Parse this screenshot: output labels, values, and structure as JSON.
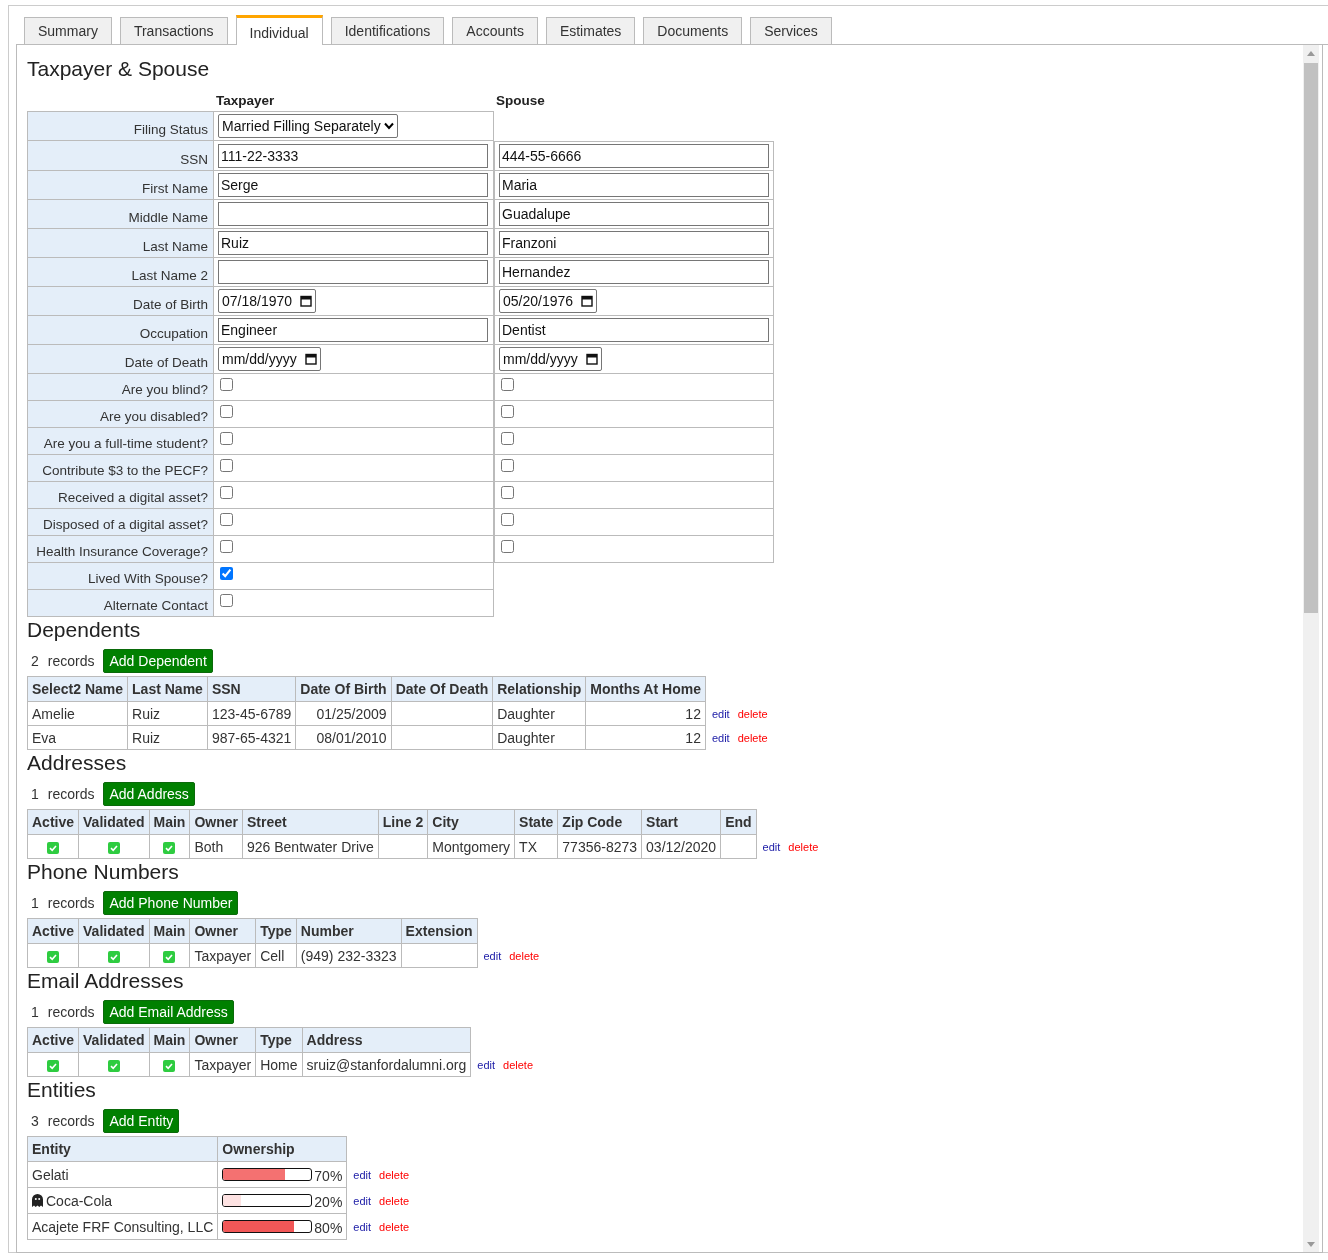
{
  "tabs": [
    {
      "label": "Summary",
      "selected": false
    },
    {
      "label": "Transactions",
      "selected": false
    },
    {
      "label": "Individual",
      "selected": true
    },
    {
      "label": "Identifications",
      "selected": false
    },
    {
      "label": "Accounts",
      "selected": false
    },
    {
      "label": "Estimates",
      "selected": false
    },
    {
      "label": "Documents",
      "selected": false
    },
    {
      "label": "Services",
      "selected": false
    }
  ],
  "taxpayer_spouse": {
    "title": "Taxpayer & Spouse",
    "columns": [
      "Taxpayer",
      "Spouse"
    ],
    "rows": [
      {
        "kind": "select",
        "label": "Filing Status",
        "taxpayer": {
          "value": "Married Filling Separately"
        }
      },
      {
        "kind": "text",
        "label": "SSN",
        "taxpayer": {
          "value": "111-22-3333"
        },
        "spouse": {
          "value": "444-55-6666"
        }
      },
      {
        "kind": "text",
        "label": "First Name",
        "taxpayer": {
          "value": "Serge"
        },
        "spouse": {
          "value": "Maria"
        }
      },
      {
        "kind": "text",
        "label": "Middle Name",
        "taxpayer": {},
        "spouse": {
          "value": "Guadalupe"
        }
      },
      {
        "kind": "text",
        "label": "Last Name",
        "taxpayer": {
          "value": "Ruiz"
        },
        "spouse": {
          "value": "Franzoni"
        }
      },
      {
        "kind": "text",
        "label": "Last Name 2",
        "taxpayer": {},
        "spouse": {
          "value": "Hernandez"
        }
      },
      {
        "kind": "date",
        "label": "Date of Birth",
        "taxpayer": {
          "value": "07/18/1970"
        },
        "spouse": {
          "value": "05/20/1976"
        }
      },
      {
        "kind": "text",
        "label": "Occupation",
        "taxpayer": {
          "value": "Engineer"
        },
        "spouse": {
          "value": "Dentist"
        }
      },
      {
        "kind": "date",
        "label": "Date of Death",
        "taxpayer": {
          "placeholder": "mm/dd/yyyy"
        },
        "spouse": {
          "placeholder": "mm/dd/yyyy"
        }
      },
      {
        "kind": "checkbox",
        "label": "Are you blind?",
        "taxpayer": {
          "checked": false
        },
        "spouse": {
          "checked": false
        }
      },
      {
        "kind": "checkbox",
        "label": "Are you disabled?",
        "taxpayer": {
          "checked": false
        },
        "spouse": {
          "checked": false
        }
      },
      {
        "kind": "checkbox",
        "label": "Are you a full-time student?",
        "taxpayer": {
          "checked": false
        },
        "spouse": {
          "checked": false
        }
      },
      {
        "kind": "checkbox",
        "label": "Contribute $3 to the PECF?",
        "taxpayer": {
          "checked": false
        },
        "spouse": {
          "checked": false
        }
      },
      {
        "kind": "checkbox",
        "label": "Received a digital asset?",
        "taxpayer": {
          "checked": false
        },
        "spouse": {
          "checked": false
        }
      },
      {
        "kind": "checkbox",
        "label": "Disposed of a digital asset?",
        "taxpayer": {
          "checked": false
        },
        "spouse": {
          "checked": false
        }
      },
      {
        "kind": "checkbox",
        "label": "Health Insurance Coverage?",
        "taxpayer": {
          "checked": false
        },
        "spouse": {
          "checked": false
        }
      },
      {
        "kind": "checkbox",
        "label": "Lived With Spouse?",
        "taxpayer": {
          "checked": true
        }
      },
      {
        "kind": "checkbox",
        "label": "Alternate Contact",
        "taxpayer": {
          "checked": false
        }
      }
    ]
  },
  "sections": [
    {
      "title": "Dependents",
      "count": "2",
      "count_label": "records",
      "add_button": "Add Dependent",
      "columns": [
        "Select2 Name",
        "Last Name",
        "SSN",
        "Date Of Birth",
        "Date Of Death",
        "Relationship",
        "Months At Home"
      ],
      "rows": [
        {
          "cells": [
            {
              "kind": "text",
              "text": "Amelie"
            },
            {
              "kind": "text",
              "text": "Ruiz"
            },
            {
              "kind": "text",
              "text": "123-45-6789"
            },
            {
              "kind": "number",
              "text": "01/25/2009"
            },
            {
              "kind": "text"
            },
            {
              "kind": "text",
              "text": "Daughter"
            },
            {
              "kind": "number",
              "text": "12"
            }
          ],
          "edit": "edit",
          "delete": "delete"
        },
        {
          "cells": [
            {
              "kind": "text",
              "text": "Eva"
            },
            {
              "kind": "text",
              "text": "Ruiz"
            },
            {
              "kind": "text",
              "text": "987-65-4321"
            },
            {
              "kind": "number",
              "text": "08/01/2010"
            },
            {
              "kind": "text"
            },
            {
              "kind": "text",
              "text": "Daughter"
            },
            {
              "kind": "number",
              "text": "12"
            }
          ],
          "edit": "edit",
          "delete": "delete"
        }
      ]
    },
    {
      "title": "Addresses",
      "count": "1",
      "count_label": "records",
      "add_button": "Add Address",
      "columns": [
        "Active",
        "Validated",
        "Main",
        "Owner",
        "Street",
        "Line 2",
        "City",
        "State",
        "Zip Code",
        "Start",
        "End"
      ],
      "rows": [
        {
          "cells": [
            {
              "kind": "check",
              "checked": true
            },
            {
              "kind": "check",
              "checked": true
            },
            {
              "kind": "check",
              "checked": true
            },
            {
              "kind": "text",
              "text": "Both"
            },
            {
              "kind": "text",
              "text": "926 Bentwater Drive"
            },
            {
              "kind": "text"
            },
            {
              "kind": "text",
              "text": "Montgomery"
            },
            {
              "kind": "text",
              "text": "TX"
            },
            {
              "kind": "text",
              "text": "77356-8273"
            },
            {
              "kind": "text",
              "text": "03/12/2020"
            },
            {
              "kind": "text"
            }
          ],
          "edit": "edit",
          "delete": "delete"
        }
      ]
    },
    {
      "title": "Phone Numbers",
      "count": "1",
      "count_label": "records",
      "add_button": "Add Phone Number",
      "columns": [
        "Active",
        "Validated",
        "Main",
        "Owner",
        "Type",
        "Number",
        "Extension"
      ],
      "rows": [
        {
          "cells": [
            {
              "kind": "check",
              "checked": true
            },
            {
              "kind": "check",
              "checked": true
            },
            {
              "kind": "check",
              "checked": true
            },
            {
              "kind": "text",
              "text": "Taxpayer"
            },
            {
              "kind": "text",
              "text": "Cell"
            },
            {
              "kind": "text",
              "text": "(949) 232-3323"
            },
            {
              "kind": "text"
            }
          ],
          "edit": "edit",
          "delete": "delete"
        }
      ]
    },
    {
      "title": "Email Addresses",
      "count": "1",
      "count_label": "records",
      "add_button": "Add Email Address",
      "columns": [
        "Active",
        "Validated",
        "Main",
        "Owner",
        "Type",
        "Address"
      ],
      "rows": [
        {
          "cells": [
            {
              "kind": "check",
              "checked": true
            },
            {
              "kind": "check",
              "checked": true
            },
            {
              "kind": "check",
              "checked": true
            },
            {
              "kind": "text",
              "text": "Taxpayer"
            },
            {
              "kind": "text",
              "text": "Home"
            },
            {
              "kind": "text",
              "text": "sruiz@stanfordalumni.org"
            }
          ],
          "edit": "edit",
          "delete": "delete"
        }
      ]
    },
    {
      "title": "Entities",
      "count": "3",
      "count_label": "records",
      "add_button": "Add Entity",
      "columns": [
        "Entity",
        "Ownership"
      ],
      "rows": [
        {
          "cells": [
            {
              "kind": "text",
              "text": "Gelati"
            },
            {
              "kind": "bar",
              "level": 0.7,
              "reading": "70%",
              "color": "#f47171"
            }
          ],
          "edit": "edit",
          "delete": "delete"
        },
        {
          "cells": [
            {
              "kind": "icon-text",
              "text": "Coca-Cola"
            },
            {
              "kind": "bar",
              "level": 0.2,
              "reading": "20%",
              "color": "#fde2e2"
            }
          ],
          "edit": "edit",
          "delete": "delete"
        },
        {
          "cells": [
            {
              "kind": "text",
              "text": "Acajete FRF Consulting, LLC"
            },
            {
              "kind": "bar",
              "level": 0.8,
              "reading": "80%",
              "color": "#f25757"
            }
          ],
          "edit": "edit",
          "delete": "delete"
        }
      ]
    }
  ]
}
